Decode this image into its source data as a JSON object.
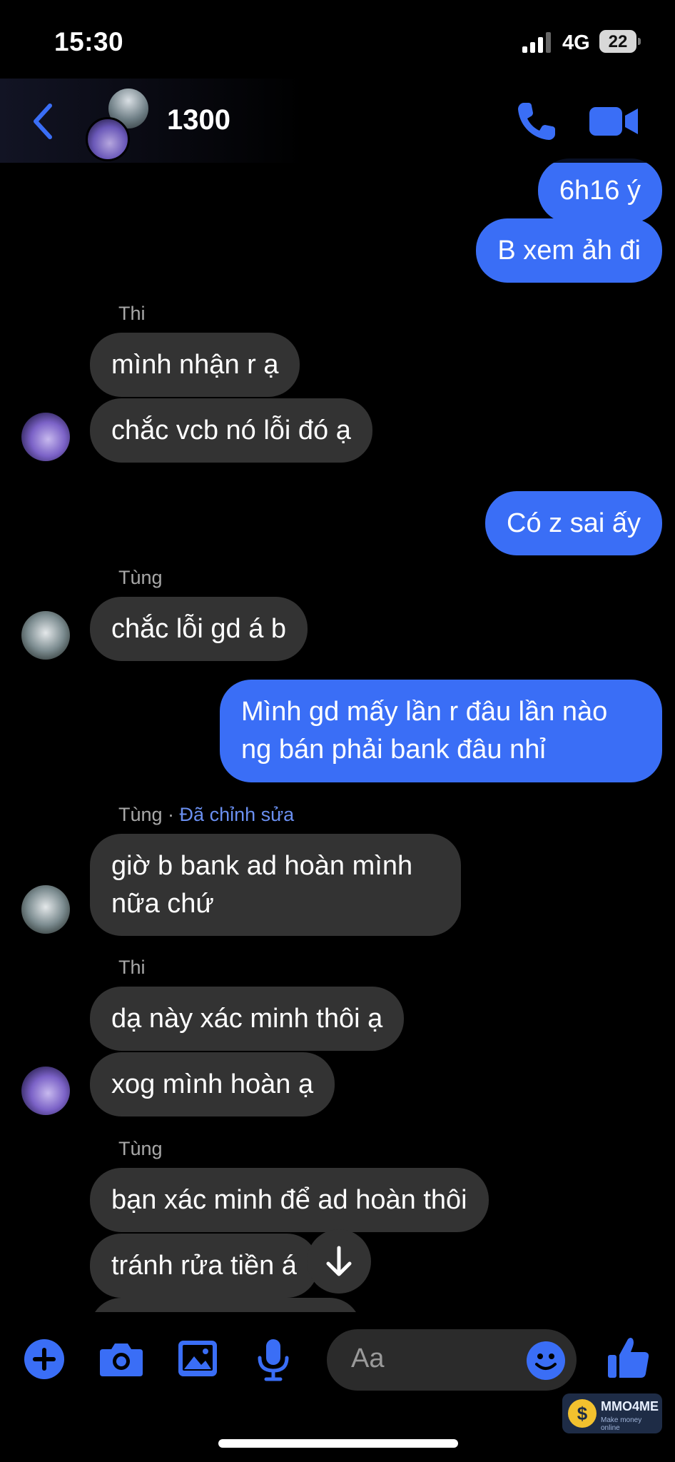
{
  "status_bar": {
    "time": "15:30",
    "network": "4G",
    "battery": "22"
  },
  "header": {
    "title": "1300"
  },
  "colors": {
    "accent": "#3a6ef6",
    "incoming_bubble": "#333333",
    "background": "#000000"
  },
  "messages": [
    {
      "kind": "outgoing",
      "text": "6h16 ý"
    },
    {
      "kind": "outgoing",
      "text": "B xem ảh đi"
    },
    {
      "kind": "sender",
      "name": "Thi"
    },
    {
      "kind": "incoming",
      "text": "mình nhận r ạ"
    },
    {
      "kind": "incoming",
      "text": "chắc vcb nó lỗi đó ạ"
    },
    {
      "kind": "outgoing",
      "text": "Có z sai ấy"
    },
    {
      "kind": "sender",
      "name": "Tùng"
    },
    {
      "kind": "incoming",
      "text": "chắc lỗi gd á b"
    },
    {
      "kind": "outgoing",
      "lines": [
        "Mình gd mấy lần r đâu lần nào",
        "ng bán phải bank đâu nhỉ"
      ]
    },
    {
      "kind": "sender",
      "name": "Tùng",
      "separator": " · ",
      "edited_label": "Đã chỉnh sửa"
    },
    {
      "kind": "incoming",
      "lines": [
        "giờ b bank ad hoàn mình",
        "nữa chứ"
      ]
    },
    {
      "kind": "sender",
      "name": "Thi"
    },
    {
      "kind": "incoming",
      "text": "dạ này xác minh thôi ạ"
    },
    {
      "kind": "incoming",
      "text": "xog mình hoàn ạ"
    },
    {
      "kind": "sender",
      "name": "Tùng"
    },
    {
      "kind": "incoming",
      "text": "bạn xác minh để ad hoàn thôi"
    },
    {
      "kind": "incoming",
      "text": "tránh rửa tiền á"
    }
  ],
  "composer": {
    "placeholder": "Aa"
  },
  "icons": [
    "back-chevron-icon",
    "phone-icon",
    "video-camera-icon",
    "arrow-down-icon",
    "plus-icon",
    "camera-icon",
    "image-icon",
    "microphone-icon",
    "emoji-icon",
    "thumbs-up-icon"
  ],
  "watermark": {
    "coin": "$",
    "name": "MMO4ME",
    "tagline": "Make money online"
  }
}
